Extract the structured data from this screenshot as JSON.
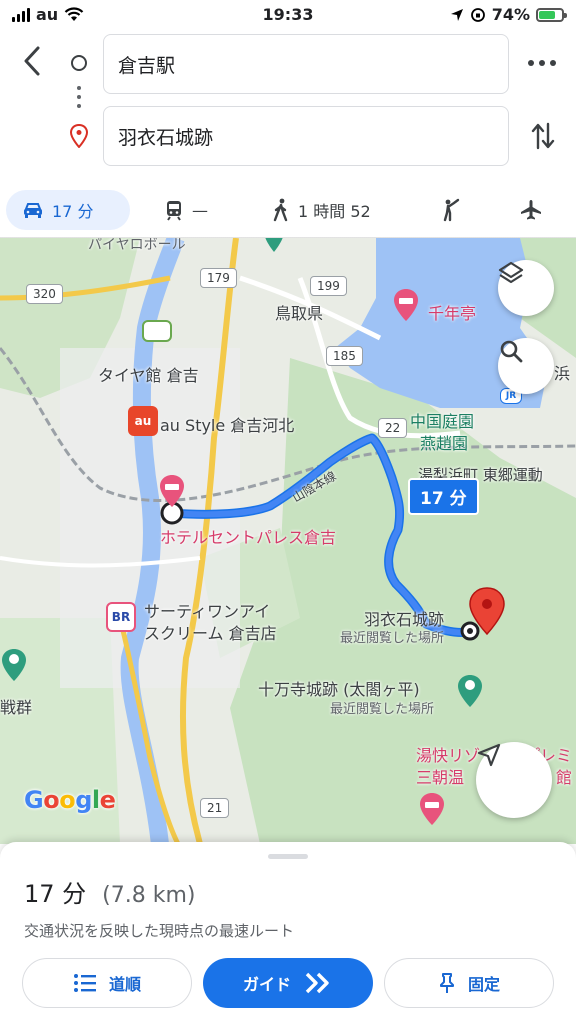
{
  "status": {
    "carrier": "au",
    "time": "19:33",
    "battery": "74%",
    "battery_level": 0.74
  },
  "search": {
    "origin": "倉吉駅",
    "destination": "羽衣石城跡"
  },
  "modes": [
    {
      "name": "car",
      "label": "17 分"
    },
    {
      "name": "transit",
      "label": "—"
    },
    {
      "name": "walk",
      "label": "1 時間 52"
    },
    {
      "name": "ride",
      "label": ""
    },
    {
      "name": "flight",
      "label": ""
    }
  ],
  "map": {
    "labels": {
      "tottori": "鳥取県",
      "sennentei": "千年亭",
      "hama": "浜",
      "taiyakan": "タイヤ館 倉吉",
      "austyle": "au Style 倉吉河北",
      "chugoku_garden": "中国庭園",
      "enshu": "燕趙園",
      "togo": "湯梨浜町 東郷運動",
      "hotel": "ホテルセントパレス倉吉",
      "baskin": "サーティワンアイ",
      "baskin2": "スクリーム 倉吉店",
      "uesshi": "羽衣石城跡",
      "recent1": "最近閲覧した場所",
      "jumanji": "十万寺城跡 (太閤ヶ平)",
      "recent2": "最近閲覧した場所",
      "yukai": "湯快リゾ",
      "sanchou": "三朝温",
      "pure": "プレミ",
      "kan": "館",
      "gun": "戦群",
      "railway": "山陰本線",
      "top_cut": "パイヤロボール"
    },
    "roads": {
      "r320": "320",
      "r179": "179",
      "r199": "199",
      "r185": "185",
      "r22": "22",
      "r21": "21"
    },
    "route_badge": "17 分",
    "poi": {
      "au": "au",
      "baskin": "BR",
      "jr": "JR"
    },
    "logo": "Google"
  },
  "sheet": {
    "eta": "17 分",
    "distance": "(7.8 km)",
    "summary": "交通状況を反映した現時点の最速ルート",
    "steps_label": "道順",
    "guide_label": "ガイド",
    "pin_label": "固定"
  },
  "colors": {
    "accent": "#1a73e8",
    "route": "#4285f4",
    "water": "#9ec2f5",
    "park": "#c8e2c0",
    "poi_pink": "#e8537c"
  }
}
